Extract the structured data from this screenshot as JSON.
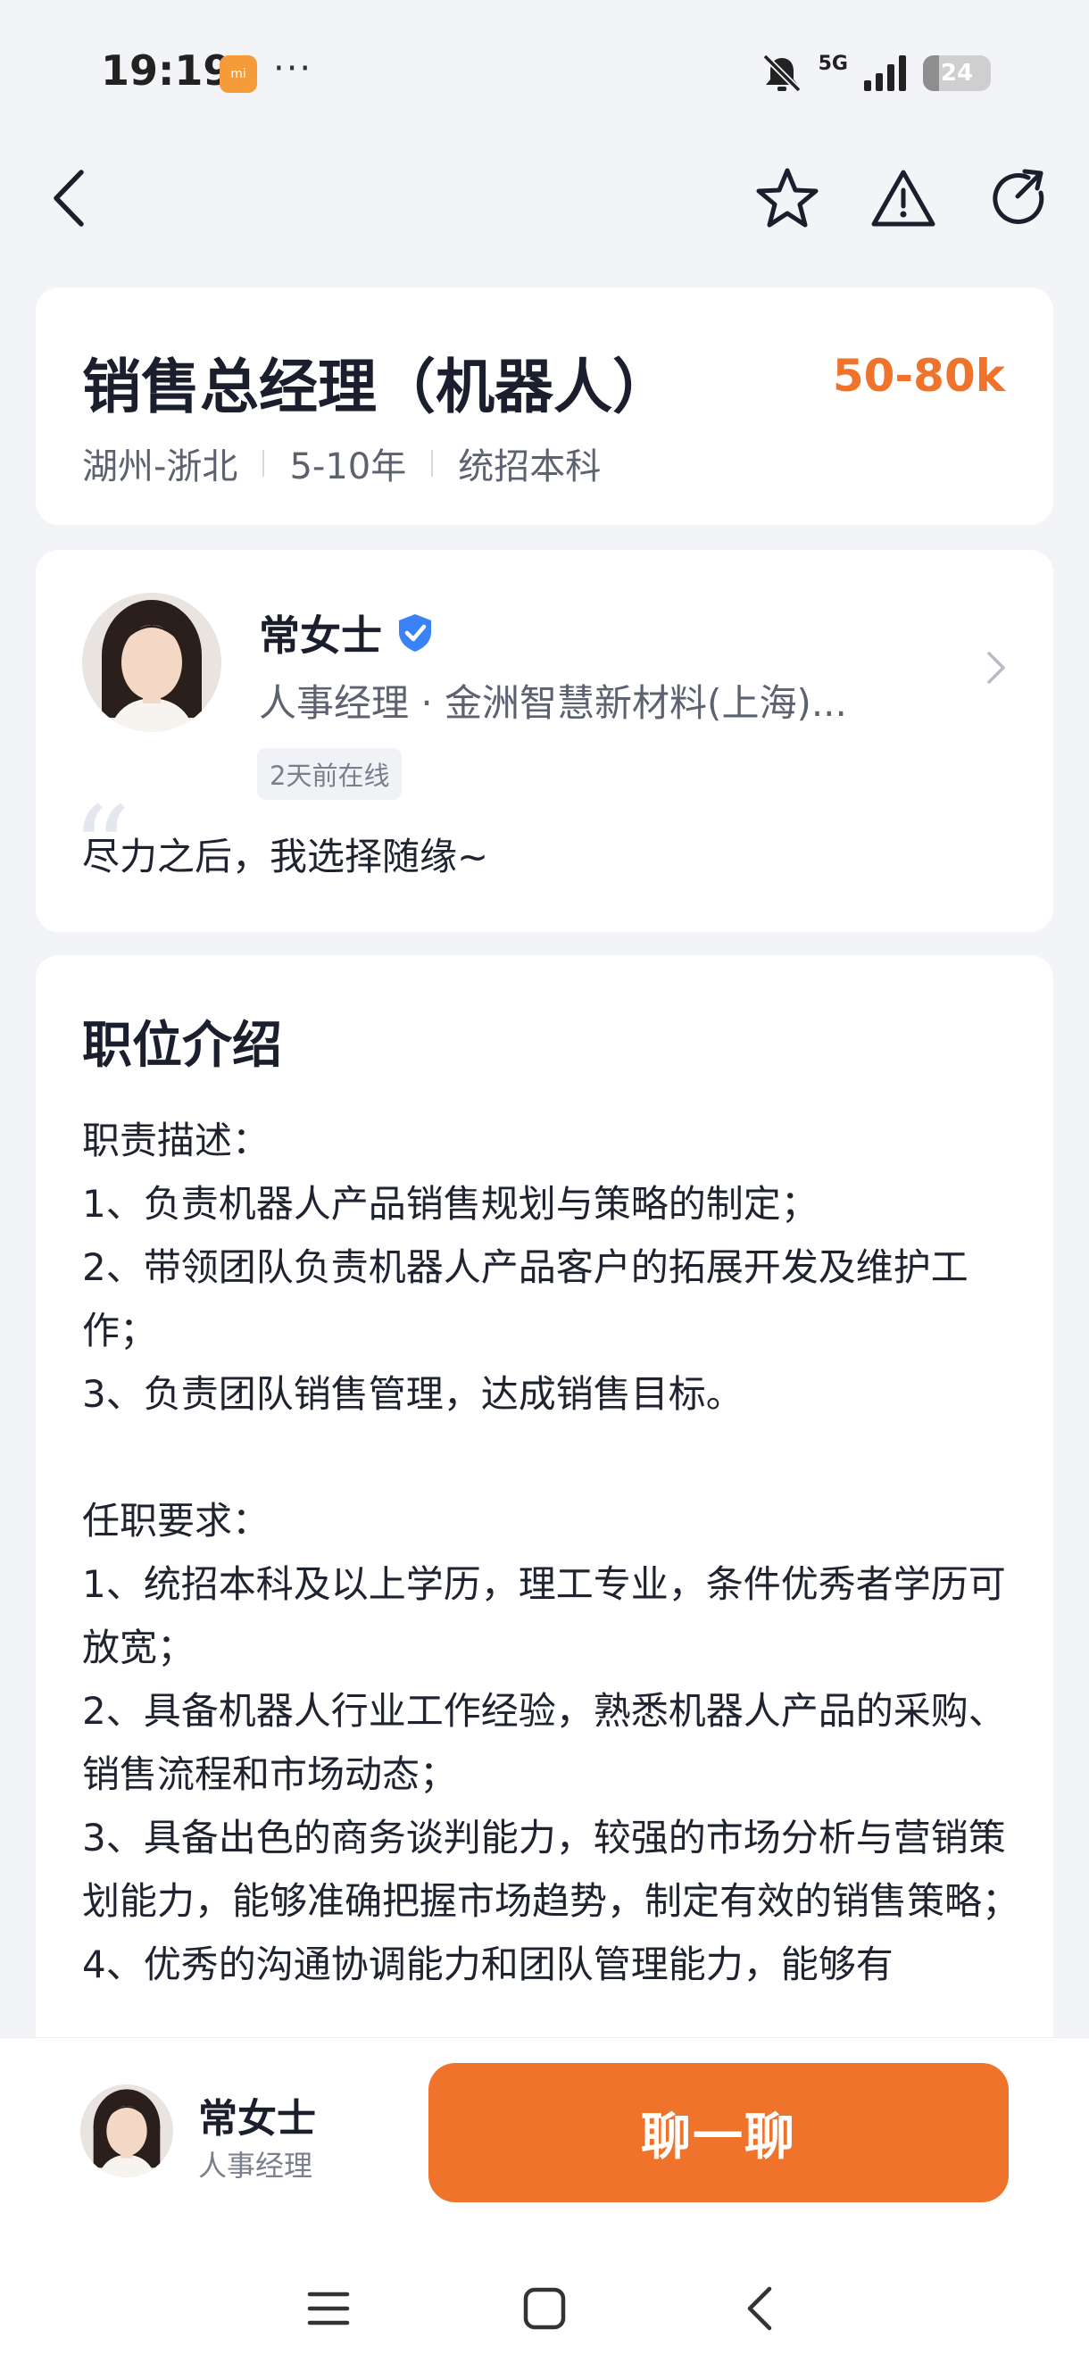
{
  "status_bar": {
    "time": "19:19",
    "app_icon_label": "mi",
    "more": "···",
    "network": "5G",
    "battery": "24",
    "battery_level": 0.24,
    "icons": [
      "mute-icon",
      "signal-icon",
      "battery-icon"
    ]
  },
  "nav": {
    "icons": [
      "back-icon",
      "star-icon",
      "warning-icon",
      "share-icon"
    ]
  },
  "job": {
    "title": "销售总经理（机器人）",
    "salary": "50-80k",
    "location": "湖州-浙北",
    "experience": "5-10年",
    "education": "统招本科"
  },
  "recruiter": {
    "name": "常女士",
    "info": "人事经理 · 金洲智慧新材料(上海)...",
    "online": "2天前在线",
    "motto": "尽力之后，我选择随缘~"
  },
  "description": {
    "title": "职位介绍",
    "lines": [
      "职责描述：",
      "1、负责机器人产品销售规划与策略的制定；",
      "2、带领团队负责机器人产品客户的拓展开发及维护工作；",
      "3、负责团队销售管理，达成销售目标。",
      "",
      "任职要求：",
      "1、统招本科及以上学历，理工专业，条件优秀者学历可放宽；",
      "2、具备机器人行业工作经验，熟悉机器人产品的采购、销售流程和市场动态；",
      "3、具备出色的商务谈判能力，较强的市场分析与营销策划能力，能够准确把握市场趋势，制定有效的销售策略；",
      "4、优秀的沟通协调能力和团队管理能力，能够有"
    ]
  },
  "action_bar": {
    "name": "常女士",
    "role": "人事经理",
    "chat_button": "聊一聊"
  },
  "colors": {
    "accent": "#f0732c",
    "background": "#f3f4f7",
    "verified": "#3b82f6"
  }
}
